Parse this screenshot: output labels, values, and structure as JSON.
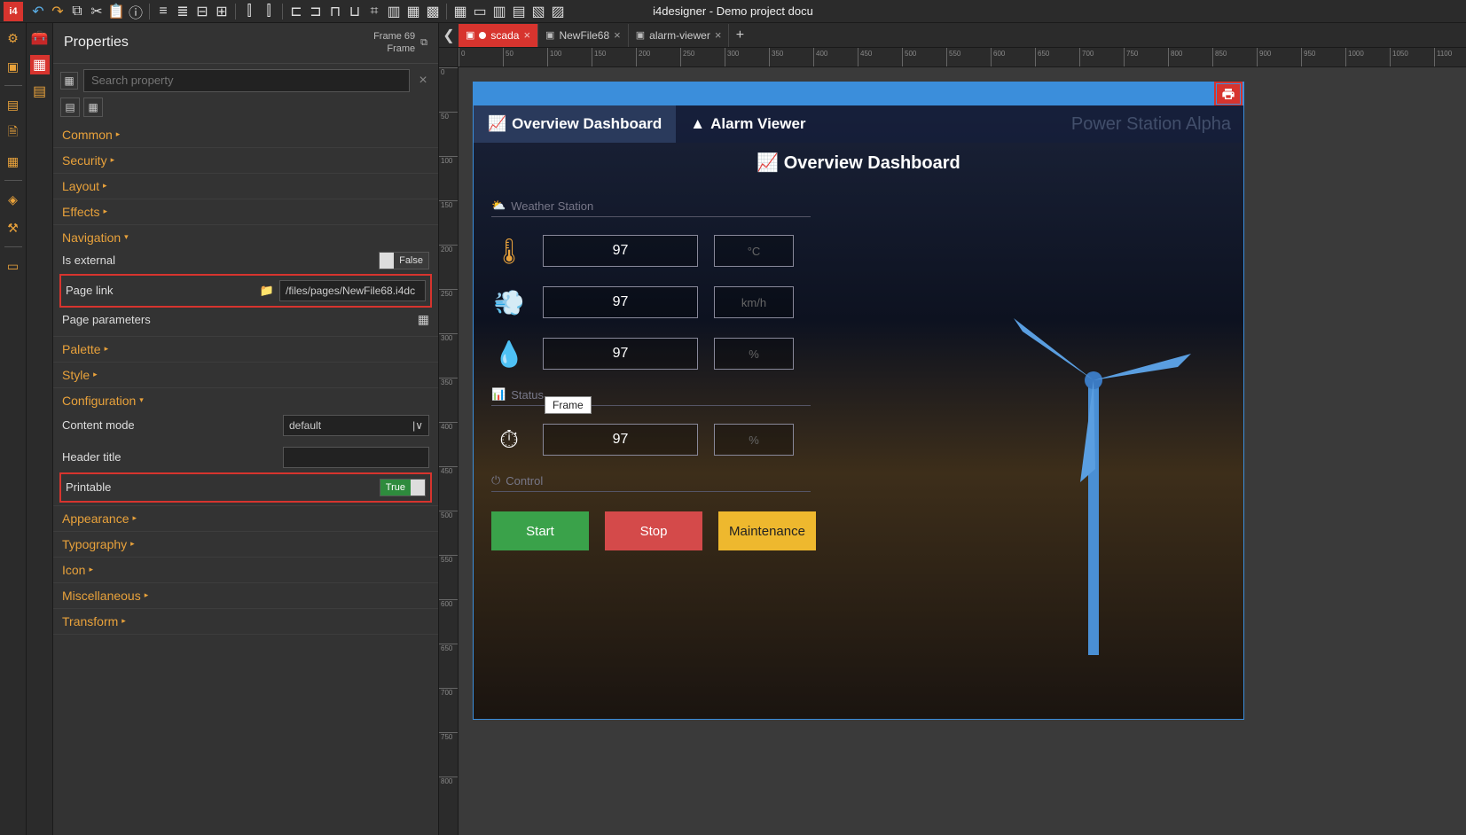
{
  "app": {
    "title": "i4designer - Demo project docu"
  },
  "toolbar_icons": [
    "undo",
    "redo",
    "copy",
    "cut",
    "paste",
    "info",
    "align-left-v",
    "align-center-v",
    "align-right-v",
    "align-dist-v",
    "align-left-h",
    "align-center-h",
    "align-right-h",
    "align-just",
    "align-top",
    "align-mid",
    "align-bot",
    "hbar",
    "vbar",
    "grid",
    "grid2",
    "grid3",
    "grid4",
    "grid5",
    "grid6",
    "grid7"
  ],
  "leftstrip_icons": [
    "gear",
    "toolbox",
    "layers",
    "pages",
    "files",
    "dash",
    "sec",
    "sec2",
    "sec3"
  ],
  "leftstrip2_icons": [
    "group",
    "list"
  ],
  "properties": {
    "title": "Properties",
    "selection_name": "Frame 69",
    "selection_type": "Frame",
    "search_placeholder": "Search property",
    "sections": {
      "common": "Common",
      "security": "Security",
      "layout": "Layout",
      "effects": "Effects",
      "navigation": "Navigation",
      "palette": "Palette",
      "style": "Style",
      "configuration": "Configuration",
      "appearance": "Appearance",
      "typography": "Typography",
      "icon": "Icon",
      "misc": "Miscellaneous",
      "transform": "Transform"
    },
    "nav": {
      "is_external_label": "Is external",
      "is_external_value": "False",
      "page_link_label": "Page link",
      "page_link_value": "/files/pages/NewFile68.i4dc",
      "page_params_label": "Page parameters"
    },
    "config": {
      "content_mode_label": "Content mode",
      "content_mode_value": "default",
      "header_title_label": "Header title",
      "header_title_value": "",
      "printable_label": "Printable",
      "printable_value": "True"
    }
  },
  "tabs": [
    {
      "label": "scada",
      "active": true,
      "dot": true
    },
    {
      "label": "NewFile68",
      "active": false,
      "dot": false
    },
    {
      "label": "alarm-viewer",
      "active": false,
      "dot": false
    }
  ],
  "dashboard": {
    "nav_overview": "Overview Dashboard",
    "nav_alarm": "Alarm Viewer",
    "station_name": "Power Station Alpha",
    "heading": "Overview Dashboard",
    "section_weather": "Weather Station",
    "section_status": "Status",
    "section_control": "Control",
    "temp_value": "97",
    "temp_unit": "°C",
    "wind_value": "97",
    "wind_unit": "km/h",
    "humid_value": "97",
    "humid_unit": "%",
    "speed_value": "97",
    "speed_unit": "%",
    "btn_start": "Start",
    "btn_stop": "Stop",
    "btn_maint": "Maintenance",
    "tooltip": "Frame"
  },
  "ruler_h": [
    "0",
    "50",
    "100",
    "150",
    "200",
    "250",
    "300",
    "350",
    "400",
    "450",
    "500",
    "550",
    "600",
    "650",
    "700",
    "750",
    "800",
    "850",
    "900",
    "950",
    "1000",
    "1050",
    "1100"
  ],
  "ruler_v": [
    "0",
    "50",
    "100",
    "150",
    "200",
    "250",
    "300",
    "350",
    "400",
    "450",
    "500",
    "550",
    "600",
    "650",
    "700",
    "750",
    "800"
  ]
}
